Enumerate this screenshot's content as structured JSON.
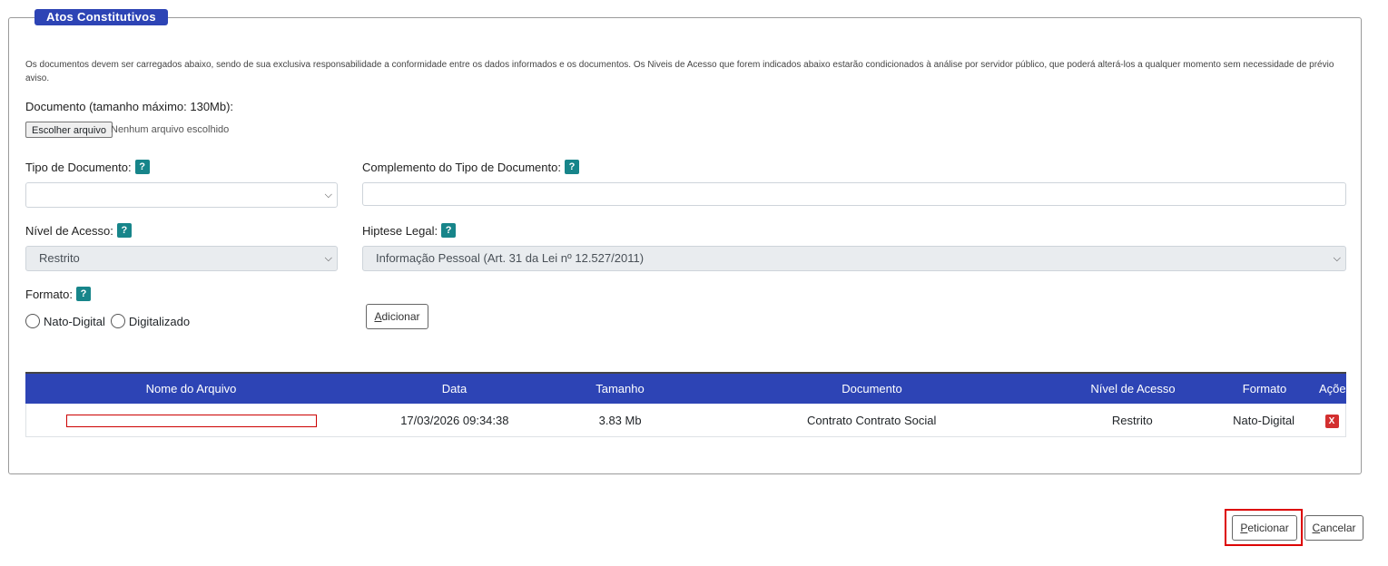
{
  "section": {
    "legend": "Atos Constitutivos",
    "notice": "Os documentos devem ser carregados abaixo, sendo de sua exclusiva responsabilidade a conformidade entre os dados informados e os documentos. Os Niveis de Acesso que forem indicados abaixo estarão condicionados à análise por servidor público, que poderá alterá-los a qualquer momento sem necessidade de prévio aviso."
  },
  "upload": {
    "label": "Documento (tamanho máximo: 130Mb):",
    "button": "Escolher arquivo",
    "status": "Nenhum arquivo escolhido"
  },
  "fields": {
    "tipo_label": "Tipo de Documento:",
    "tipo_value": "",
    "complemento_label": "Complemento do Tipo de Documento:",
    "complemento_value": "",
    "nivel_label": "Nível de Acesso:",
    "nivel_value": "Restrito",
    "hipotese_label": "Hiptese Legal:",
    "hipotese_value": "Informação Pessoal (Art. 31 da Lei nº 12.527/2011)",
    "formato_label": "Formato:",
    "help": "?"
  },
  "radios": {
    "nato": "Nato-Digital",
    "digitalizado": "Digitalizado"
  },
  "buttons": {
    "adicionar_key": "A",
    "adicionar_rest": "dicionar",
    "peticionar_key": "P",
    "peticionar_rest": "eticionar",
    "cancelar_key": "C",
    "cancelar_rest": "ancelar"
  },
  "table": {
    "headers": [
      "Nome do Arquivo",
      "Data",
      "Tamanho",
      "Documento",
      "Nível de Acesso",
      "Formato",
      "Ações"
    ],
    "rows": [
      {
        "nome": "",
        "data": "17/03/2026 09:34:38",
        "tamanho": "3.83 Mb",
        "documento": "Contrato Contrato Social",
        "nivel": "Restrito",
        "formato": "Nato-Digital",
        "acao": "X"
      }
    ]
  },
  "colors": {
    "header_blue": "#2d44b5",
    "help_teal": "#17858a",
    "delete_red": "#d32f2f",
    "highlight_red": "#dd0000"
  }
}
